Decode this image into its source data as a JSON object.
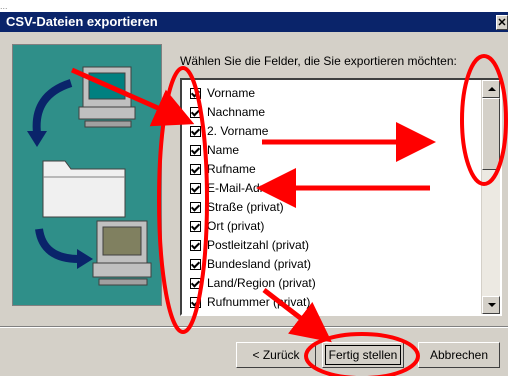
{
  "window": {
    "title": "CSV-Dateien exportieren",
    "close_glyph": "✕",
    "faint_text": "..."
  },
  "prompt": "Wählen Sie die Felder, die Sie exportieren möchten:",
  "fields": [
    {
      "label": "Vorname",
      "checked": true
    },
    {
      "label": "Nachname",
      "checked": true
    },
    {
      "label": "2. Vorname",
      "checked": true
    },
    {
      "label": "Name",
      "checked": true
    },
    {
      "label": "Rufname",
      "checked": true
    },
    {
      "label": "E-Mail-Adresse",
      "checked": true
    },
    {
      "label": "Straße (privat)",
      "checked": true
    },
    {
      "label": "Ort (privat)",
      "checked": true
    },
    {
      "label": "Postleitzahl (privat)",
      "checked": true
    },
    {
      "label": "Bundesland (privat)",
      "checked": true
    },
    {
      "label": "Land/Region (privat)",
      "checked": true
    },
    {
      "label": "Rufnummer (privat)",
      "checked": true
    }
  ],
  "buttons": {
    "back": "< Zurück",
    "finish": "Fertig stellen",
    "cancel": "Abbrechen"
  },
  "colors": {
    "titlebar": "#0a246a",
    "art_bg": "#2f8f89",
    "annotation_red": "#ff0000"
  },
  "icons": [
    "computer-icon",
    "folder-icon",
    "computer-icon",
    "curved-arrow-icon"
  ]
}
